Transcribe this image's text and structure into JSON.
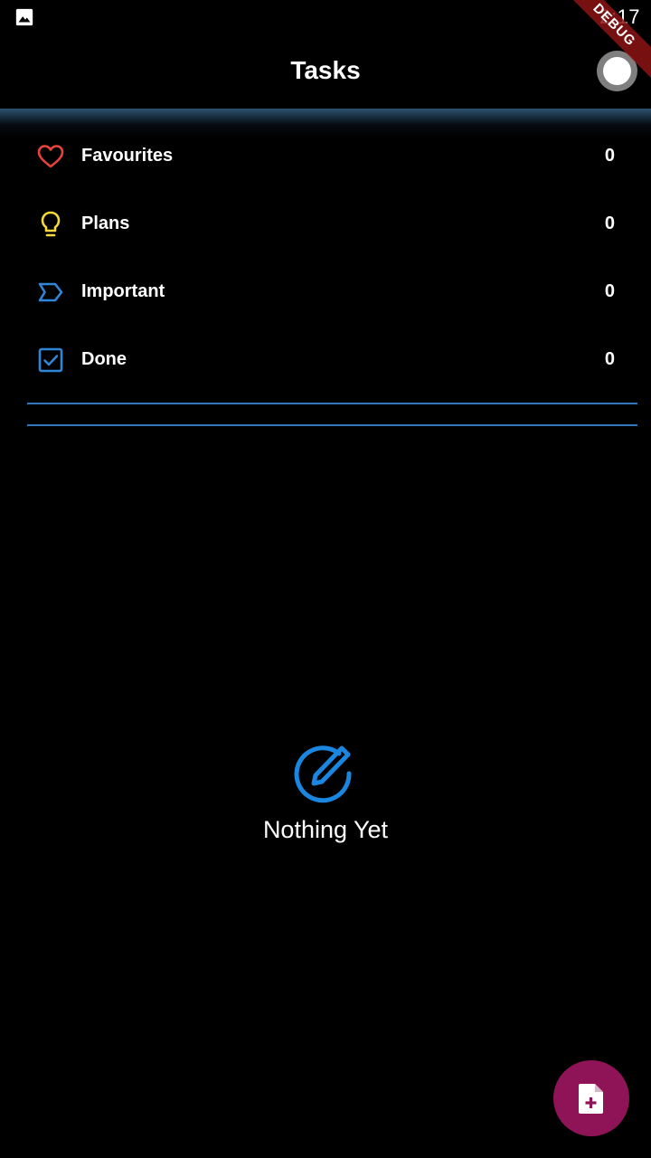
{
  "status_bar": {
    "time": "2:17",
    "image_icon": "image-icon"
  },
  "debug_banner": "DEBUG",
  "app_bar": {
    "title": "Tasks",
    "toggle_icon": "theme-toggle-icon"
  },
  "categories": [
    {
      "label": "Favourites",
      "count": "0",
      "icon": "heart-icon",
      "color": "#e8433a"
    },
    {
      "label": "Plans",
      "count": "0",
      "icon": "lightbulb-icon",
      "color": "#f5d93a"
    },
    {
      "label": "Important",
      "count": "0",
      "icon": "label-icon",
      "color": "#2f86d8"
    },
    {
      "label": "Done",
      "count": "0",
      "icon": "checkbox-icon",
      "color": "#2f86d8"
    }
  ],
  "empty_state": {
    "icon": "edit-circle-icon",
    "text": "Nothing Yet"
  },
  "fab": {
    "icon": "add-note-icon",
    "color": "#8e1457"
  },
  "colors": {
    "background": "#000000",
    "accent_blue": "#2f78c0",
    "text": "#ffffff"
  }
}
